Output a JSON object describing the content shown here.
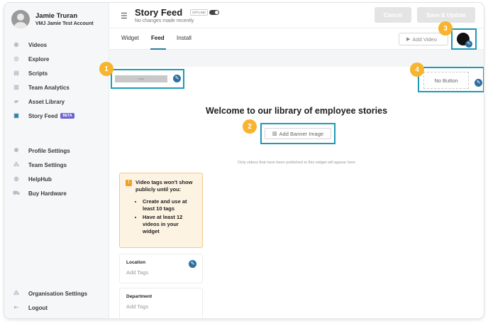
{
  "user": {
    "name": "Jamie Truran",
    "account": "VMJ Jamie Test Account"
  },
  "nav_main": [
    {
      "label": "Videos",
      "icon": "eye-icon"
    },
    {
      "label": "Explore",
      "icon": "compass-icon"
    },
    {
      "label": "Scripts",
      "icon": "script-icon"
    },
    {
      "label": "Team Analytics",
      "icon": "bar-chart-icon"
    },
    {
      "label": "Asset Library",
      "icon": "folder-icon"
    },
    {
      "label": "Story Feed",
      "icon": "feed-icon",
      "badge": "BETA",
      "active": true
    }
  ],
  "nav_secondary": [
    {
      "label": "Profile Settings",
      "icon": "gear-icon"
    },
    {
      "label": "Team Settings",
      "icon": "team-icon"
    },
    {
      "label": "HelpHub",
      "icon": "help-icon"
    },
    {
      "label": "Buy Hardware",
      "icon": "cart-icon"
    }
  ],
  "nav_bottom": [
    {
      "label": "Organisation Settings",
      "icon": "org-icon"
    },
    {
      "label": "Logout",
      "icon": "logout-icon"
    }
  ],
  "header": {
    "title": "Story Feed",
    "status": "OFFLINE",
    "subtitle": "No changes made recently",
    "cancel_label": "Cancel",
    "save_label": "Save & Update"
  },
  "tabs": [
    {
      "label": "Widget"
    },
    {
      "label": "Feed",
      "active": true
    },
    {
      "label": "Install"
    }
  ],
  "add_video_label": "Add Video",
  "logo_placeholder": "Logo",
  "no_button_label": "No Button",
  "welcome": "Welcome to our library of employee stories",
  "banner_label": "Add Banner Image",
  "note": "Only videos that have been published to this widget will appear here",
  "warning": {
    "title": "Video tags won't show publicly until you:",
    "items": [
      "Create and use at least 10 tags",
      "Have at least 12 videos in your widget"
    ]
  },
  "tag_cards": [
    {
      "label": "Location",
      "value": "Add Tags"
    },
    {
      "label": "Department",
      "value": "Add Tags"
    }
  ],
  "callouts": [
    "1",
    "2",
    "3",
    "4"
  ],
  "colors": {
    "accent": "#1b9bb6",
    "badge": "#f7b42c",
    "beta": "#6b63d8"
  }
}
